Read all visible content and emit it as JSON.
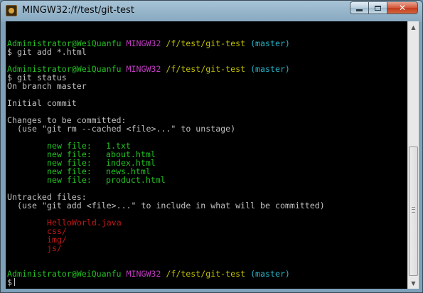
{
  "window": {
    "title": "MINGW32:/f/test/git-test",
    "icon": "git-bash-icon",
    "buttons": {
      "minimize": "minimize-icon",
      "maximize": "maximize-icon",
      "close": "✕"
    }
  },
  "prompt": {
    "user": "Administrator@WeiQuanfu",
    "system": "MINGW32",
    "path": "/f/test/git-test",
    "branch": "(master)",
    "symbol": "$"
  },
  "commands": {
    "add": "git add *.html",
    "status": "git status"
  },
  "status": {
    "branch_line": "On branch master",
    "initial_commit": "Initial commit",
    "staged_header": "Changes to be committed:",
    "staged_hint": "(use \"git rm --cached <file>...\" to unstage)",
    "staged": [
      {
        "label": "new file:",
        "file": "1.txt"
      },
      {
        "label": "new file:",
        "file": "about.html"
      },
      {
        "label": "new file:",
        "file": "index.html"
      },
      {
        "label": "new file:",
        "file": "news.html"
      },
      {
        "label": "new file:",
        "file": "product.html"
      }
    ],
    "untracked_header": "Untracked files:",
    "untracked_hint": "(use \"git add <file>...\" to include in what will be committed)",
    "untracked": [
      "HelloWorld.java",
      "css/",
      "img/",
      "js/"
    ]
  },
  "colors": {
    "user": "#22c022",
    "system": "#c03bc0",
    "path": "#c0c000",
    "branch": "#27b5c8",
    "untracked": "#c01818",
    "text": "#c0c0c0",
    "background": "#000000"
  },
  "scrollbar": {
    "up_arrow": "▲",
    "down_arrow": "▼",
    "position_fraction": 0.56
  }
}
